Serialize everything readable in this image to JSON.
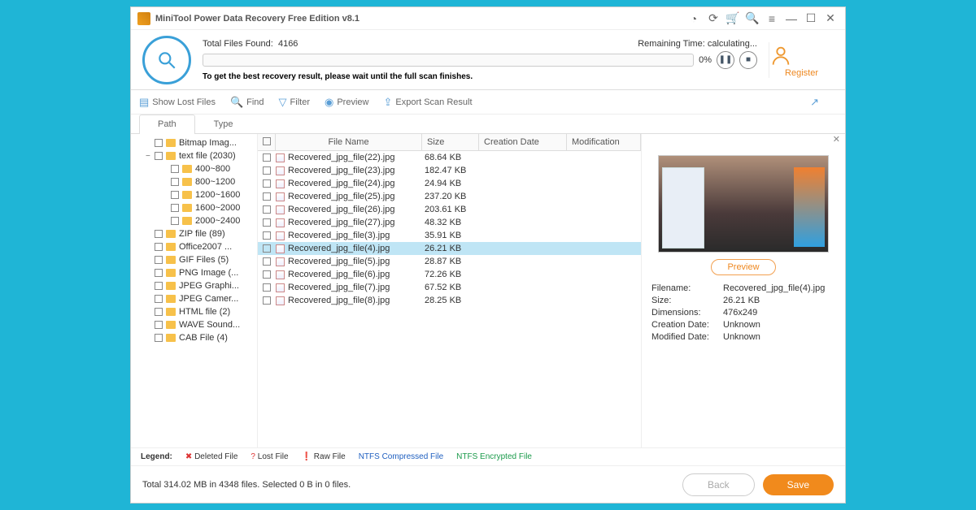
{
  "title": "MiniTool Power Data Recovery Free Edition v8.1",
  "scan": {
    "found_label": "Total Files Found:",
    "found_count": "4166",
    "remaining_label": "Remaining Time:",
    "remaining_value": "calculating...",
    "percent": "0%",
    "tip": "To get the best recovery result, please wait until the full scan finishes."
  },
  "register_label": "Register",
  "toolbar": {
    "show_lost": "Show Lost Files",
    "find": "Find",
    "filter": "Filter",
    "preview": "Preview",
    "export": "Export Scan Result"
  },
  "tabs": {
    "path": "Path",
    "type": "Type"
  },
  "tree": [
    {
      "label": "Bitmap Imag...",
      "indent": false,
      "exp": ""
    },
    {
      "label": "text file (2030)",
      "indent": false,
      "exp": "−"
    },
    {
      "label": "400~800",
      "indent": true,
      "exp": ""
    },
    {
      "label": "800~1200",
      "indent": true,
      "exp": ""
    },
    {
      "label": "1200~1600",
      "indent": true,
      "exp": ""
    },
    {
      "label": "1600~2000",
      "indent": true,
      "exp": ""
    },
    {
      "label": "2000~2400",
      "indent": true,
      "exp": ""
    },
    {
      "label": "ZIP file (89)",
      "indent": false,
      "exp": ""
    },
    {
      "label": "Office2007 ...",
      "indent": false,
      "exp": ""
    },
    {
      "label": "GIF Files (5)",
      "indent": false,
      "exp": ""
    },
    {
      "label": "PNG Image (...",
      "indent": false,
      "exp": ""
    },
    {
      "label": "JPEG Graphi...",
      "indent": false,
      "exp": ""
    },
    {
      "label": "JPEG Camer...",
      "indent": false,
      "exp": ""
    },
    {
      "label": "HTML file (2)",
      "indent": false,
      "exp": ""
    },
    {
      "label": "WAVE Sound...",
      "indent": false,
      "exp": ""
    },
    {
      "label": "CAB File (4)",
      "indent": false,
      "exp": ""
    }
  ],
  "columns": {
    "name": "File Name",
    "size": "Size",
    "cdate": "Creation Date",
    "mdate": "Modification"
  },
  "files": [
    {
      "name": "Recovered_jpg_file(22).jpg",
      "size": "68.64 KB"
    },
    {
      "name": "Recovered_jpg_file(23).jpg",
      "size": "182.47 KB"
    },
    {
      "name": "Recovered_jpg_file(24).jpg",
      "size": "24.94 KB"
    },
    {
      "name": "Recovered_jpg_file(25).jpg",
      "size": "237.20 KB"
    },
    {
      "name": "Recovered_jpg_file(26).jpg",
      "size": "203.61 KB"
    },
    {
      "name": "Recovered_jpg_file(27).jpg",
      "size": "48.32 KB"
    },
    {
      "name": "Recovered_jpg_file(3).jpg",
      "size": "35.91 KB"
    },
    {
      "name": "Recovered_jpg_file(4).jpg",
      "size": "26.21 KB",
      "sel": true
    },
    {
      "name": "Recovered_jpg_file(5).jpg",
      "size": "28.87 KB"
    },
    {
      "name": "Recovered_jpg_file(6).jpg",
      "size": "72.26 KB"
    },
    {
      "name": "Recovered_jpg_file(7).jpg",
      "size": "67.52 KB"
    },
    {
      "name": "Recovered_jpg_file(8).jpg",
      "size": "28.25 KB"
    }
  ],
  "preview": {
    "btn": "Preview",
    "filename_k": "Filename:",
    "filename_v": "Recovered_jpg_file(4).jpg",
    "size_k": "Size:",
    "size_v": "26.21 KB",
    "dim_k": "Dimensions:",
    "dim_v": "476x249",
    "cdate_k": "Creation Date:",
    "cdate_v": "Unknown",
    "mdate_k": "Modified Date:",
    "mdate_v": "Unknown"
  },
  "legend": {
    "label": "Legend:",
    "deleted": "Deleted File",
    "lost": "Lost File",
    "raw": "Raw File",
    "ntfs": "NTFS Compressed File",
    "enc": "NTFS Encrypted File"
  },
  "footer": {
    "text": "Total 314.02 MB in 4348 files. Selected 0 B in 0 files.",
    "back": "Back",
    "save": "Save"
  }
}
